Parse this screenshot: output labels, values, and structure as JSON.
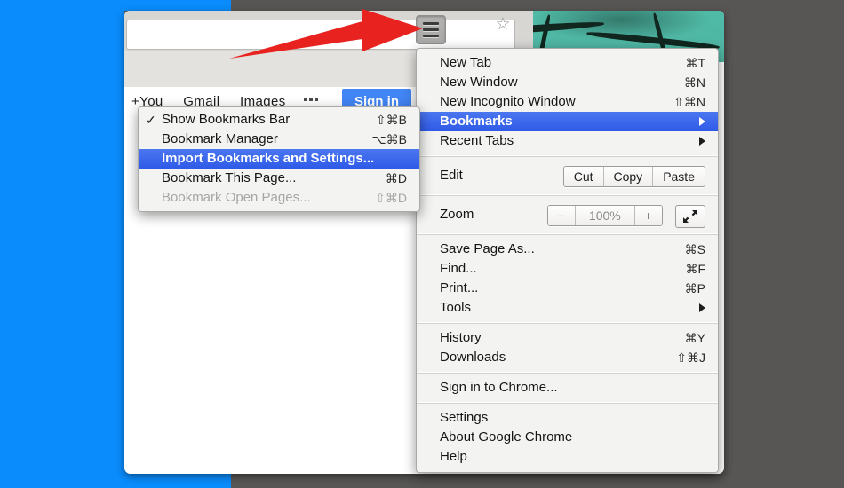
{
  "desktop": {
    "background_color": "#0a8cfc",
    "outer_color": "#585654"
  },
  "browser": {
    "theme_color": "#4fb7a4",
    "omnibox": {
      "value": "",
      "placeholder": "",
      "star_icon": "star-icon"
    },
    "hamburger": {
      "icon": "hamburger-menu-icon",
      "label": ""
    },
    "page": {
      "links": [
        "+You",
        "Gmail",
        "Images"
      ],
      "apps_icon": "apps-grid-icon",
      "signin_label": "Sign in"
    }
  },
  "annotation": {
    "arrow_color": "#e8231f",
    "icon": "red-arrow-icon"
  },
  "main_menu": {
    "accent_highlight": "#2f5ae8",
    "groups": [
      {
        "items": [
          {
            "label": "New Tab",
            "shortcut": "⌘T",
            "type": "item"
          },
          {
            "label": "New Window",
            "shortcut": "⌘N",
            "type": "item"
          },
          {
            "label": "New Incognito Window",
            "shortcut": "⇧⌘N",
            "type": "item"
          },
          {
            "label": "Bookmarks",
            "shortcut": "",
            "type": "submenu",
            "highlighted": true
          },
          {
            "label": "Recent Tabs",
            "shortcut": "",
            "type": "submenu"
          }
        ]
      },
      {
        "items": [
          {
            "label": "Edit",
            "type": "control",
            "buttons": [
              "Cut",
              "Copy",
              "Paste"
            ]
          },
          {
            "label": "Zoom",
            "type": "control",
            "buttons": [
              "−",
              "100%",
              "+"
            ],
            "extra_icon": "fullscreen-icon"
          }
        ]
      },
      {
        "items": [
          {
            "label": "Save Page As...",
            "shortcut": "⌘S",
            "type": "item"
          },
          {
            "label": "Find...",
            "shortcut": "⌘F",
            "type": "item"
          },
          {
            "label": "Print...",
            "shortcut": "⌘P",
            "type": "item"
          },
          {
            "label": "Tools",
            "shortcut": "",
            "type": "submenu"
          }
        ]
      },
      {
        "items": [
          {
            "label": "History",
            "shortcut": "⌘Y",
            "type": "item"
          },
          {
            "label": "Downloads",
            "shortcut": "⇧⌘J",
            "type": "item"
          }
        ]
      },
      {
        "items": [
          {
            "label": "Sign in to Chrome...",
            "shortcut": "",
            "type": "item"
          }
        ]
      },
      {
        "items": [
          {
            "label": "Settings",
            "shortcut": "",
            "type": "item"
          },
          {
            "label": "About Google Chrome",
            "shortcut": "",
            "type": "item"
          },
          {
            "label": "Help",
            "shortcut": "",
            "type": "item"
          }
        ]
      }
    ]
  },
  "bookmarks_submenu": {
    "items": [
      {
        "label": "Show Bookmarks Bar",
        "shortcut": "⇧⌘B",
        "checked": true
      },
      {
        "label": "Bookmark Manager",
        "shortcut": "⌥⌘B"
      },
      {
        "label": "Import Bookmarks and Settings...",
        "shortcut": "",
        "highlighted": true
      },
      {
        "label": "Bookmark This Page...",
        "shortcut": "⌘D"
      },
      {
        "label": "Bookmark Open Pages...",
        "shortcut": "⇧⌘D",
        "disabled": true
      }
    ]
  }
}
